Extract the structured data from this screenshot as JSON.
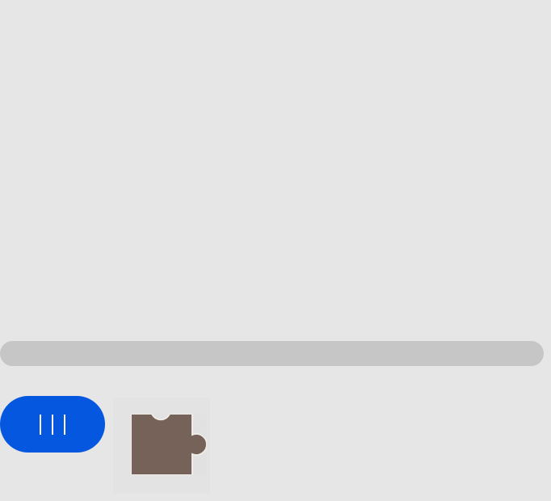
{
  "captcha": {
    "puzzle_area": {
      "description": ""
    },
    "slider": {
      "progress": 0,
      "handle_icon": "grip-lines-icon",
      "colors": {
        "track": "#c6c6c6",
        "handle": "#0557e0",
        "grip": "#ffffff"
      }
    },
    "puzzle_piece": {
      "icon": "puzzle-piece-icon",
      "colors": {
        "fill": "#766359",
        "outline": "#f1ede9",
        "background": "#e3e3e3"
      }
    }
  }
}
